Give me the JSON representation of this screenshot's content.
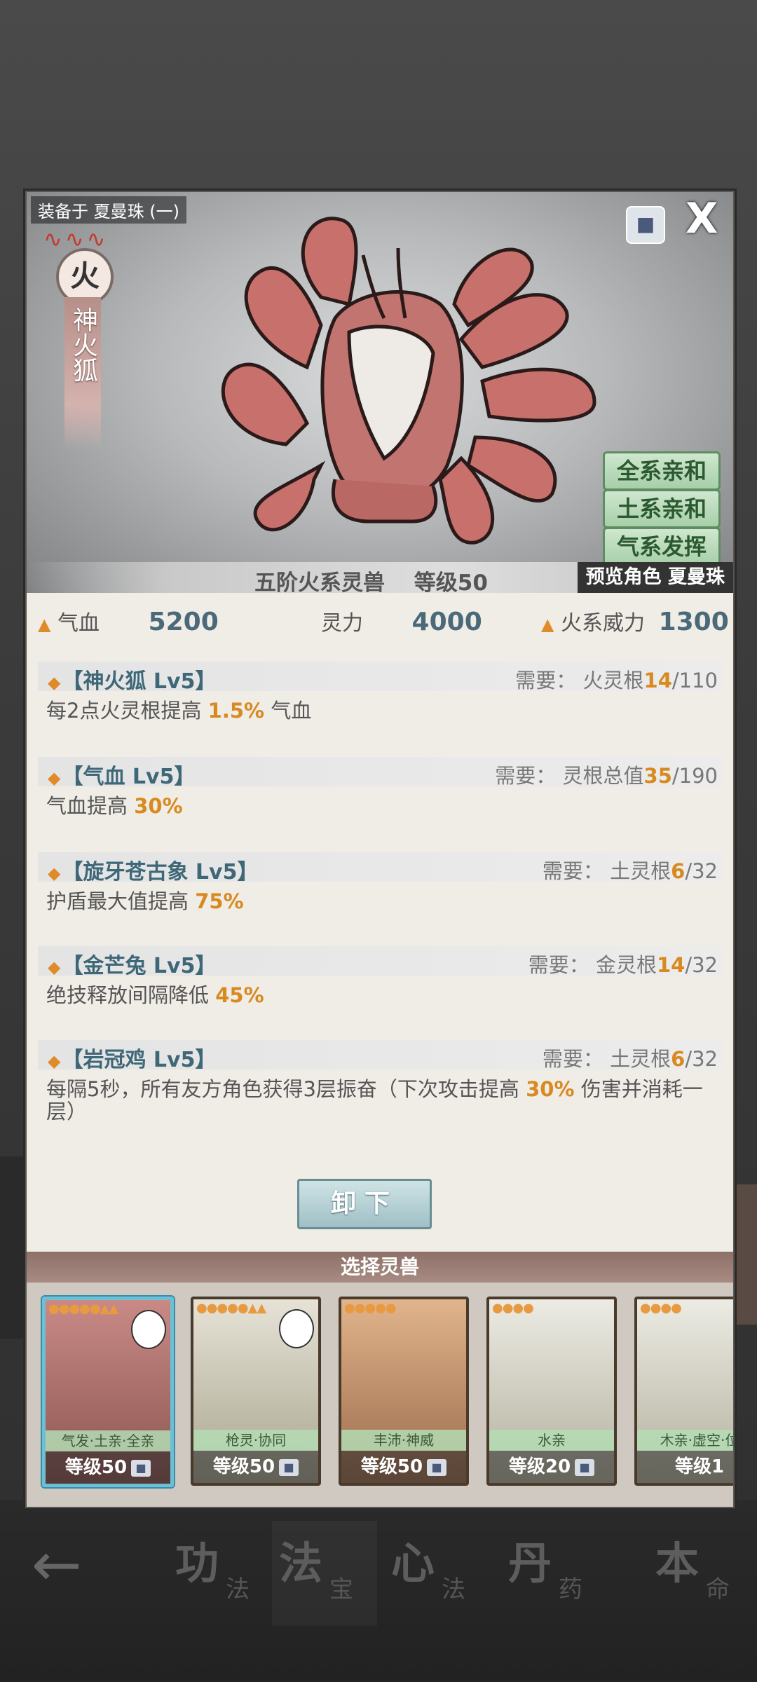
{
  "hero": {
    "equipped_label": "装备于 夏曼珠 (一)",
    "element_glyph": "火",
    "beast_name": "神火狐",
    "skill_chips": [
      "全系亲和",
      "土系亲和",
      "气系发挥"
    ],
    "tier_text": "五阶火系灵兽　 等级50",
    "preview_label": "预览角色 夏曼珠",
    "close_glyph": "X"
  },
  "stats": [
    {
      "label": "气血",
      "value": "5200",
      "arrow": true
    },
    {
      "label": "灵力",
      "value": "4000",
      "arrow": false
    },
    {
      "label": "火系威力",
      "value": "1300",
      "arrow": true
    }
  ],
  "effects": [
    {
      "title": "【神火狐 Lv5】",
      "req_label": "需要：",
      "req_name": "火灵根",
      "req_cur": "14",
      "req_max": "/110",
      "desc_pre": "每2点火灵根提高 ",
      "desc_hi": "1.5%",
      "desc_post": " 气血"
    },
    {
      "title": "【气血 Lv5】",
      "req_label": "需要：",
      "req_name": "灵根总值",
      "req_cur": "35",
      "req_max": "/190",
      "desc_pre": "气血提高 ",
      "desc_hi": "30%",
      "desc_post": ""
    },
    {
      "title": "【旋牙苍古象 Lv5】",
      "req_label": "需要：",
      "req_name": "土灵根",
      "req_cur": "6",
      "req_max": "/32",
      "desc_pre": "护盾最大值提高 ",
      "desc_hi": "75%",
      "desc_post": ""
    },
    {
      "title": "【金芒兔 Lv5】",
      "req_label": "需要：",
      "req_name": "金灵根",
      "req_cur": "14",
      "req_max": "/32",
      "desc_pre": "绝技释放间隔降低 ",
      "desc_hi": "45%",
      "desc_post": ""
    },
    {
      "title": "【岩冠鸡 Lv5】",
      "req_label": "需要：",
      "req_name": "土灵根",
      "req_cur": "6",
      "req_max": "/32",
      "desc_pre": "每隔5秒，所有友方角色获得3层振奋（下次攻击提高 ",
      "desc_hi": "30%",
      "desc_post": " 伤害并消耗一层）"
    }
  ],
  "unequip_label": "卸下",
  "select_label": "选择灵兽",
  "cards": [
    {
      "tags": "气发·土亲·全亲",
      "level": "等级50",
      "colors": [
        "#c98a86",
        "#8a5450"
      ]
    },
    {
      "tags": "枪灵·协同",
      "level": "等级50",
      "colors": [
        "#e6e2d6",
        "#a9a58f"
      ]
    },
    {
      "tags": "丰沛·神威",
      "level": "等级50",
      "colors": [
        "#e0b48c",
        "#9a6a4a"
      ]
    },
    {
      "tags": "水亲",
      "level": "等级20",
      "colors": [
        "#ecebe4",
        "#b3b09c"
      ]
    },
    {
      "tags": "木亲·虚空·位",
      "level": "等级1",
      "colors": [
        "#ecebe4",
        "#b3b09c"
      ]
    }
  ],
  "nav": [
    {
      "big": "功",
      "small": "法"
    },
    {
      "big": "法",
      "small": "宝"
    },
    {
      "big": "心",
      "small": "法"
    },
    {
      "big": "丹",
      "small": "药"
    },
    {
      "big": "本",
      "small": "命"
    }
  ],
  "colors": {
    "accent_orange": "#d88a20",
    "stat_blue": "#4a6a7a",
    "effect_title": "#3e6878"
  },
  "icons": {
    "back": "left-arrow-icon",
    "chest": "chest-icon",
    "close": "close-icon"
  }
}
